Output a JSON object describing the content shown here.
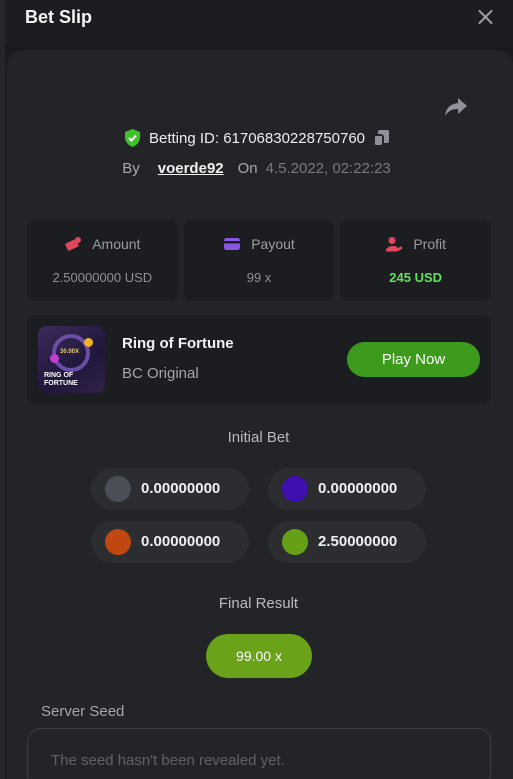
{
  "header": {
    "title": "Bet Slip"
  },
  "bet": {
    "id_label": "Betting ID: ",
    "id_value": "61706830228750760",
    "by_label": "By",
    "user": "voerde92",
    "on_label": "On",
    "date": "4.5.2022, 02:22:23"
  },
  "stats": {
    "amount": {
      "label": "Amount",
      "value": "2.50000000 USD"
    },
    "payout": {
      "label": "Payout",
      "value": "99 x"
    },
    "profit": {
      "label": "Profit",
      "value": "245 USD"
    }
  },
  "game": {
    "name": "Ring of Fortune",
    "subtitle": "BC Original",
    "play_label": "Play Now",
    "thumb_line1": "RING OF",
    "thumb_line2": "FORTUNE",
    "thumb_mult": "30.00X"
  },
  "initial_bet": {
    "title": "Initial Bet",
    "chips": [
      {
        "color": "#4a4e57",
        "value": "0.00000000"
      },
      {
        "color": "#3f0fb0",
        "value": "0.00000000"
      },
      {
        "color": "#bf4810",
        "value": "0.00000000"
      },
      {
        "color": "#66a017",
        "value": "2.50000000"
      }
    ]
  },
  "final_result": {
    "title": "Final Result",
    "value": "99.00 x"
  },
  "server_seed": {
    "label": "Server Seed",
    "placeholder": "The seed hasn't been revealed yet."
  },
  "colors": {
    "accent_green": "#3c9a1c",
    "profit_green": "#5ee35a",
    "result_green": "#6aa21a"
  }
}
